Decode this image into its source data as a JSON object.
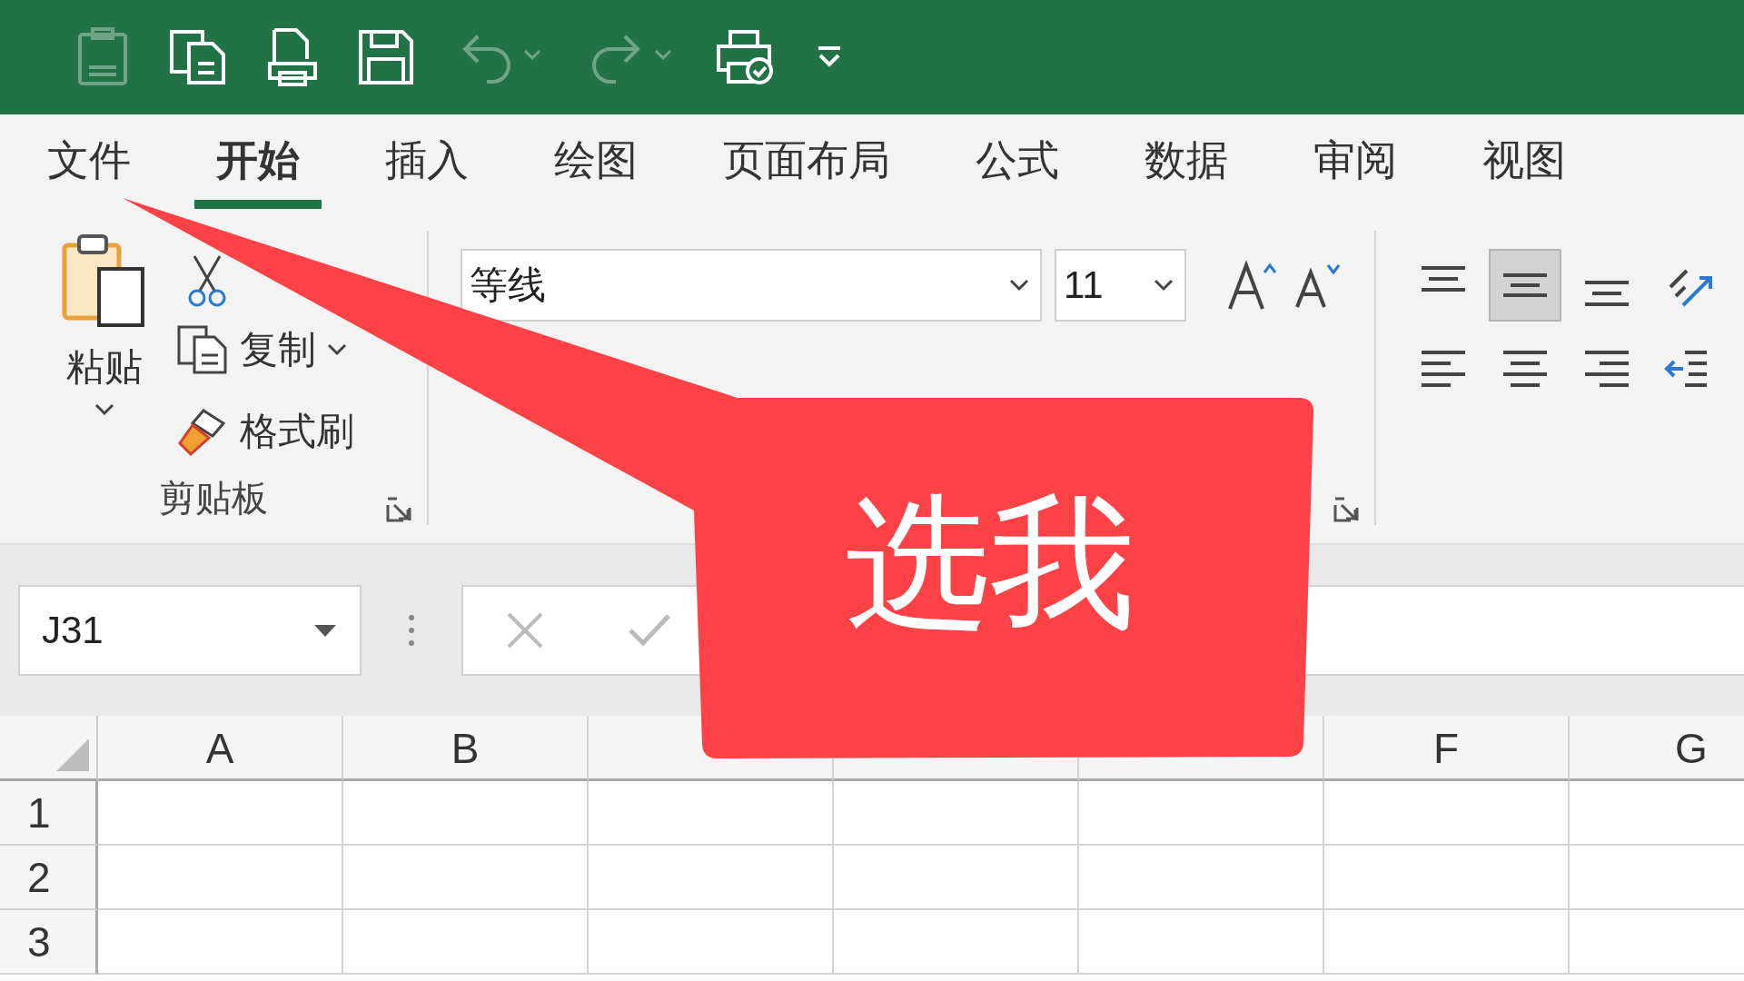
{
  "quick_access": [
    {
      "kind": "paste-values",
      "disabled": true
    },
    {
      "kind": "copy",
      "disabled": false
    },
    {
      "kind": "print-preview",
      "disabled": false
    },
    {
      "kind": "save",
      "disabled": false
    },
    {
      "kind": "undo",
      "disabled": true
    },
    {
      "kind": "redo",
      "disabled": true
    },
    {
      "kind": "print",
      "disabled": false
    },
    {
      "kind": "customize",
      "disabled": false
    }
  ],
  "tabs": [
    {
      "label": "文件",
      "selected": false
    },
    {
      "label": "开始",
      "selected": true
    },
    {
      "label": "插入",
      "selected": false
    },
    {
      "label": "绘图",
      "selected": false
    },
    {
      "label": "页面布局",
      "selected": false
    },
    {
      "label": "公式",
      "selected": false
    },
    {
      "label": "数据",
      "selected": false
    },
    {
      "label": "审阅",
      "selected": false
    },
    {
      "label": "视图",
      "selected": false
    }
  ],
  "clipboard": {
    "paste": "粘贴",
    "copy": "复制",
    "format_painter": "格式刷",
    "group_label": "剪贴板"
  },
  "font": {
    "name": "等线",
    "size": "11"
  },
  "alignment": {
    "vertical": [
      {
        "kind": "top",
        "selected": false
      },
      {
        "kind": "middle",
        "selected": true
      },
      {
        "kind": "bottom",
        "selected": false
      }
    ]
  },
  "formula_bar": {
    "name_box": "J31"
  },
  "sheet": {
    "columns": [
      {
        "label": "A"
      },
      {
        "label": "B"
      },
      {},
      {},
      {},
      {
        "label": "F"
      },
      {
        "label": "G"
      }
    ],
    "rows": [
      "1",
      "2",
      "3"
    ]
  },
  "callout": {
    "text": "选我"
  }
}
